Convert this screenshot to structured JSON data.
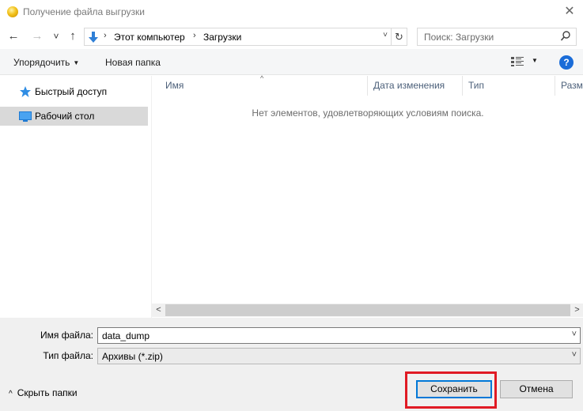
{
  "window": {
    "title": "Получение файла выгрузки",
    "close_symbol": "✕",
    "icon": "app-orb-icon"
  },
  "nav": {
    "back": "←",
    "forward": "→",
    "recent": "˅",
    "up": "↑",
    "breadcrumb": [
      "Этот компьютер",
      "Загрузки"
    ],
    "separator": "›",
    "dropdown": "˅",
    "refresh": "↻",
    "search_placeholder": "Поиск: Загрузки"
  },
  "toolbar": {
    "organize": "Упорядочить",
    "new_folder": "Новая папка",
    "caret": "▼",
    "help": "?"
  },
  "sidebar": {
    "items": [
      {
        "label": "Быстрый доступ",
        "icon": "star-icon",
        "selected": false
      },
      {
        "label": "Рабочий стол",
        "icon": "desktop-icon",
        "selected": true
      }
    ]
  },
  "columns": [
    "Имя",
    "Дата изменения",
    "Тип",
    "Разм"
  ],
  "sort_indicator": "^",
  "empty_message": "Нет элементов, удовлетворяющих условиям поиска.",
  "scroll": {
    "left": "<",
    "right": ">"
  },
  "form": {
    "filename_label": "Имя файла:",
    "filename_value": "data_dump",
    "filetype_label": "Тип файла:",
    "filetype_value": "Архивы (*.zip)",
    "dropdown": "˅"
  },
  "footer": {
    "hide_folders": "Скрыть папки",
    "chevron": "^",
    "save": "Сохранить",
    "cancel": "Отмена"
  },
  "colors": {
    "accent": "#0078d7",
    "highlight": "#e01a24",
    "help": "#1a6cd8"
  }
}
